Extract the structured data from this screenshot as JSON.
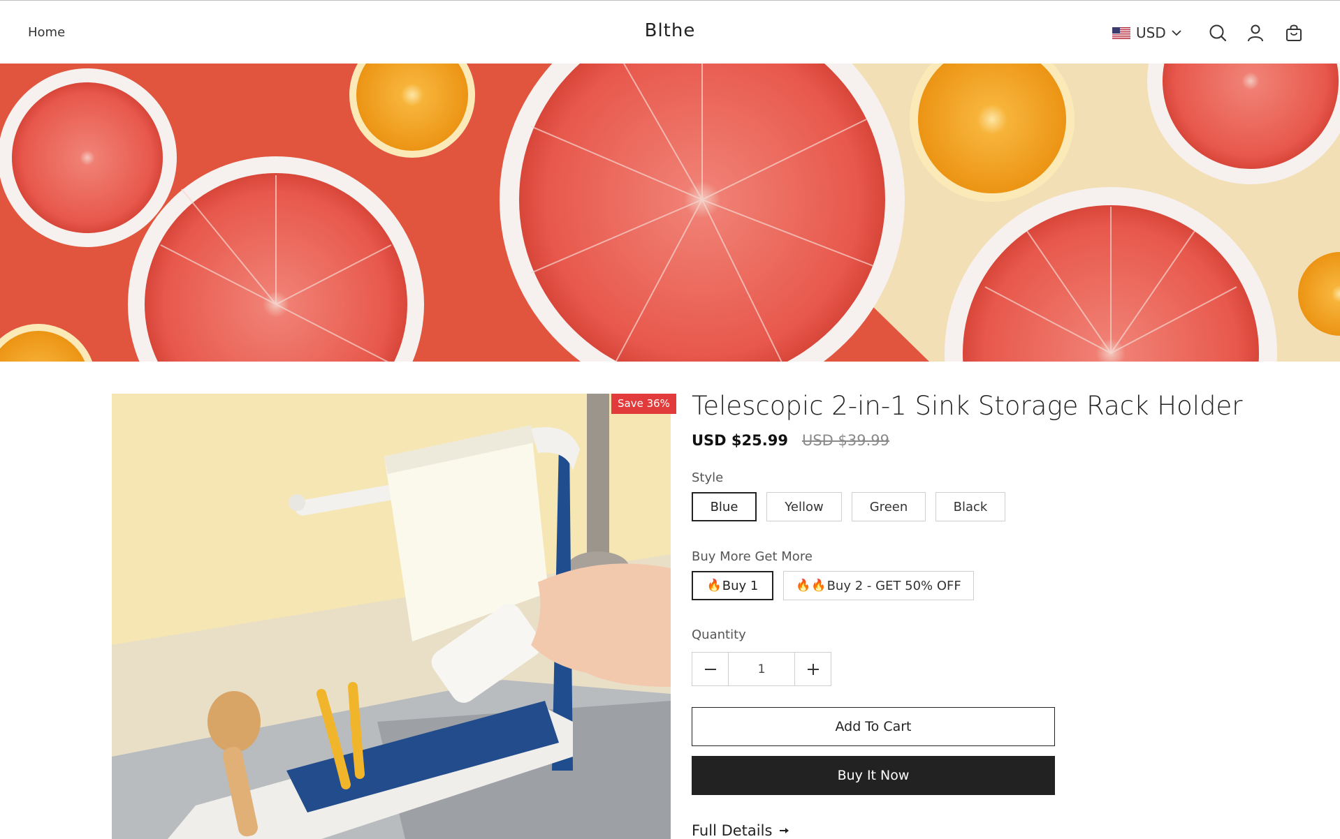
{
  "header": {
    "nav_home": "Home",
    "brand": "Blthe",
    "currency": "USD",
    "icons": [
      "search-icon",
      "account-icon",
      "cart-icon"
    ]
  },
  "hero": {
    "image": "grapefruit-slices-banner"
  },
  "product": {
    "save_badge": "Save 36%",
    "title": "Telescopic 2-in-1 Sink Storage Rack Holder",
    "price": "USD $25.99",
    "compare_price": "USD $39.99",
    "style": {
      "label": "Style",
      "selected": "Blue",
      "options": [
        "Blue",
        "Yellow",
        "Green",
        "Black"
      ]
    },
    "bundle": {
      "label": "Buy More Get More",
      "options": [
        "Buy 1",
        "Buy 2 - GET 50% OFF"
      ]
    },
    "quantity": {
      "label": "Quantity",
      "value": "1"
    },
    "add_to_cart": "Add To Cart",
    "buy_now": "Buy It Now",
    "full_details": "Full Details"
  },
  "colors": {
    "accent": "#222222",
    "badge": "#e23b3b"
  }
}
